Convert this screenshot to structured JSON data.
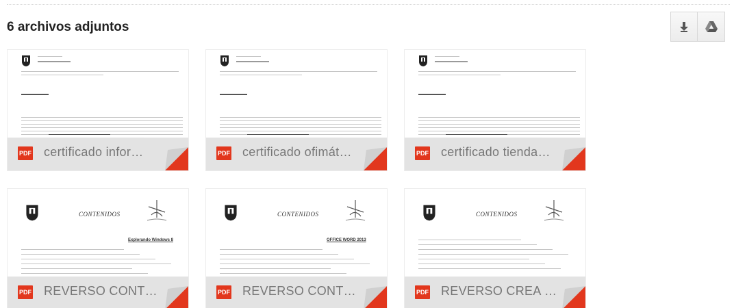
{
  "header": {
    "title": "6 archivos adjuntos"
  },
  "toolbar": {
    "download_icon": "download-arrow-icon",
    "drive_icon": "google-drive-icon"
  },
  "attachments": [
    {
      "name": "certificado infor…",
      "type": "PDF",
      "badge": "PDF",
      "thumbnail": "certificate"
    },
    {
      "name": "certificado ofimát…",
      "type": "PDF",
      "badge": "PDF",
      "thumbnail": "certificate"
    },
    {
      "name": "certificado tienda…",
      "type": "PDF",
      "badge": "PDF",
      "thumbnail": "certificate"
    },
    {
      "name": "REVERSO CONT…",
      "type": "PDF",
      "badge": "PDF",
      "thumbnail": "contents",
      "thumb_heading": "CONTENIDOS",
      "thumb_subheading": "Explorando Windows 8"
    },
    {
      "name": "REVERSO CONT…",
      "type": "PDF",
      "badge": "PDF",
      "thumbnail": "contents",
      "thumb_heading": "CONTENIDOS",
      "thumb_subheading": "OFFICE WORD 2013"
    },
    {
      "name": "REVERSO CREA …",
      "type": "PDF",
      "badge": "PDF",
      "thumbnail": "contents",
      "thumb_heading": "CONTENIDOS",
      "thumb_subheading": ""
    }
  ],
  "colors": {
    "pdf_red": "#e2371d",
    "footer_gray": "#e1e1e1",
    "filename_gray": "#777777"
  }
}
